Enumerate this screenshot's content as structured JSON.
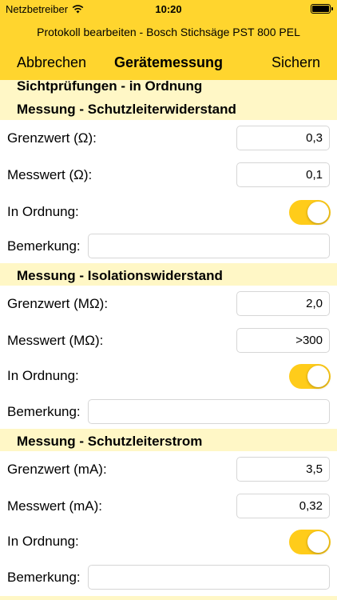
{
  "status_bar": {
    "carrier": "Netzbetreiber",
    "time": "10:20"
  },
  "header": {
    "subtitle": "Protokoll bearbeiten - Bosch Stichsäge PST 800 PEL",
    "cancel_label": "Abbrechen",
    "title": "Gerätemessung",
    "save_label": "Sichern"
  },
  "sections": {
    "visual": "Sichtprüfungen - in Ordnung",
    "protective_conductor_resistance": "Messung - Schutzleiterwiderstand",
    "insulation_resistance": "Messung - Isolationswiderstand",
    "protective_conductor_current": "Messung - Schutzleiterstrom"
  },
  "measurements": [
    {
      "limit_label": "Grenzwert (Ω):",
      "limit_value": "0,3",
      "measured_label": "Messwert (Ω):",
      "measured_value": "0,1",
      "ok_label": "In Ordnung:",
      "ok": true,
      "remark_label": "Bemerkung:",
      "remark": ""
    },
    {
      "limit_label": "Grenzwert (MΩ):",
      "limit_value": "2,0",
      "measured_label": "Messwert (MΩ):",
      "measured_value": ">300",
      "ok_label": "In Ordnung:",
      "ok": true,
      "remark_label": "Bemerkung:",
      "remark": ""
    },
    {
      "limit_label": "Grenzwert (mA):",
      "limit_value": "3,5",
      "measured_label": "Messwert (mA):",
      "measured_value": "0,32",
      "ok_label": "In Ordnung:",
      "ok": true,
      "remark_label": "Bemerkung:",
      "remark": ""
    }
  ],
  "colors": {
    "accent": "#FFD52E",
    "section_bg": "#FFF7C6",
    "toggle_on": "#FFCC1A"
  }
}
